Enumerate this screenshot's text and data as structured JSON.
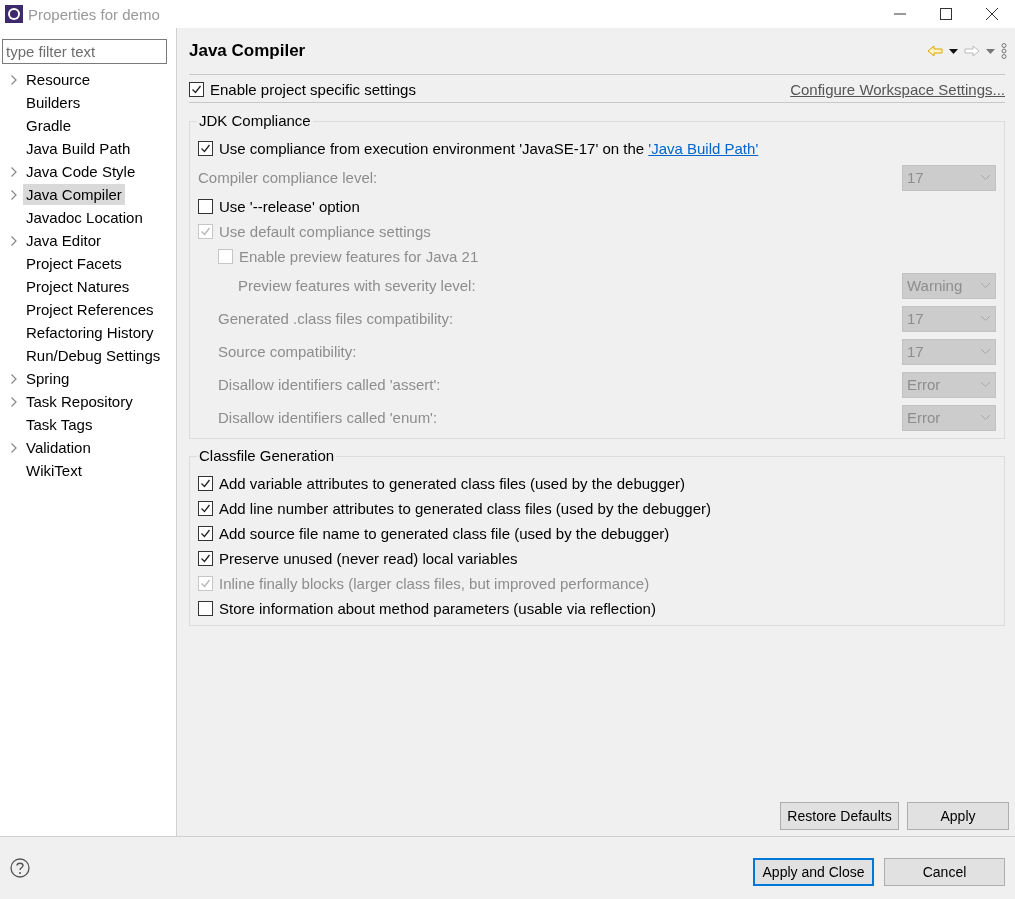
{
  "window": {
    "title": "Properties for demo"
  },
  "filter": {
    "placeholder": "type filter text"
  },
  "tree": [
    {
      "label": "Resource",
      "expander": true,
      "selected": false
    },
    {
      "label": "Builders",
      "expander": false,
      "selected": false
    },
    {
      "label": "Gradle",
      "expander": false,
      "selected": false
    },
    {
      "label": "Java Build Path",
      "expander": false,
      "selected": false
    },
    {
      "label": "Java Code Style",
      "expander": true,
      "selected": false
    },
    {
      "label": "Java Compiler",
      "expander": true,
      "selected": true
    },
    {
      "label": "Javadoc Location",
      "expander": false,
      "selected": false
    },
    {
      "label": "Java Editor",
      "expander": true,
      "selected": false
    },
    {
      "label": "Project Facets",
      "expander": false,
      "selected": false
    },
    {
      "label": "Project Natures",
      "expander": false,
      "selected": false
    },
    {
      "label": "Project References",
      "expander": false,
      "selected": false
    },
    {
      "label": "Refactoring History",
      "expander": false,
      "selected": false
    },
    {
      "label": "Run/Debug Settings",
      "expander": false,
      "selected": false
    },
    {
      "label": "Spring",
      "expander": true,
      "selected": false
    },
    {
      "label": "Task Repository",
      "expander": true,
      "selected": false
    },
    {
      "label": "Task Tags",
      "expander": false,
      "selected": false
    },
    {
      "label": "Validation",
      "expander": true,
      "selected": false
    },
    {
      "label": "WikiText",
      "expander": false,
      "selected": false
    }
  ],
  "page": {
    "title": "Java Compiler",
    "project_specific": {
      "label": "Enable project specific settings",
      "checked": true
    },
    "workspace_link": "Configure Workspace Settings...",
    "groups": [
      {
        "title": "JDK Compliance",
        "rows": [
          {
            "kind": "check",
            "label": "Use compliance from execution environment 'JavaSE-17' on the ",
            "link": "'Java Build Path'",
            "checked": true,
            "disabled": false
          },
          {
            "kind": "select",
            "label": "Compiler compliance level:",
            "value": "17",
            "disabled": true
          },
          {
            "kind": "check",
            "label": "Use '--release' option",
            "checked": false,
            "disabled": false
          },
          {
            "kind": "check",
            "label": "Use default compliance settings",
            "checked": true,
            "disabled": true,
            "children": [
              {
                "kind": "check",
                "label": "Enable preview features for Java 21",
                "checked": false,
                "disabled": true,
                "children": [
                  {
                    "kind": "select",
                    "label": "Preview features with severity level:",
                    "value": "Warning",
                    "disabled": true
                  }
                ]
              },
              {
                "kind": "select",
                "label": "Generated .class files compatibility:",
                "value": "17",
                "disabled": true
              },
              {
                "kind": "select",
                "label": "Source compatibility:",
                "value": "17",
                "disabled": true
              },
              {
                "kind": "select",
                "label": "Disallow identifiers called 'assert':",
                "value": "Error",
                "disabled": true
              },
              {
                "kind": "select",
                "label": "Disallow identifiers called 'enum':",
                "value": "Error",
                "disabled": true
              }
            ]
          }
        ]
      },
      {
        "title": "Classfile Generation",
        "rows": [
          {
            "kind": "check",
            "label": "Add variable attributes to generated class files (used by the debugger)",
            "checked": true,
            "disabled": false
          },
          {
            "kind": "check",
            "label": "Add line number attributes to generated class files (used by the debugger)",
            "checked": true,
            "disabled": false
          },
          {
            "kind": "check",
            "label": "Add source file name to generated class file (used by the debugger)",
            "checked": true,
            "disabled": false
          },
          {
            "kind": "check",
            "label": "Preserve unused (never read) local variables",
            "checked": true,
            "disabled": false
          },
          {
            "kind": "check",
            "label": "Inline finally blocks (larger class files, but improved performance)",
            "checked": true,
            "disabled": true
          },
          {
            "kind": "check",
            "label": "Store information about method parameters (usable via reflection)",
            "checked": false,
            "disabled": false
          }
        ]
      }
    ],
    "buttons": [
      "Restore Defaults",
      "Apply"
    ]
  },
  "footer_buttons": [
    {
      "label": "Apply and Close",
      "default": true
    },
    {
      "label": "Cancel",
      "default": false
    }
  ]
}
